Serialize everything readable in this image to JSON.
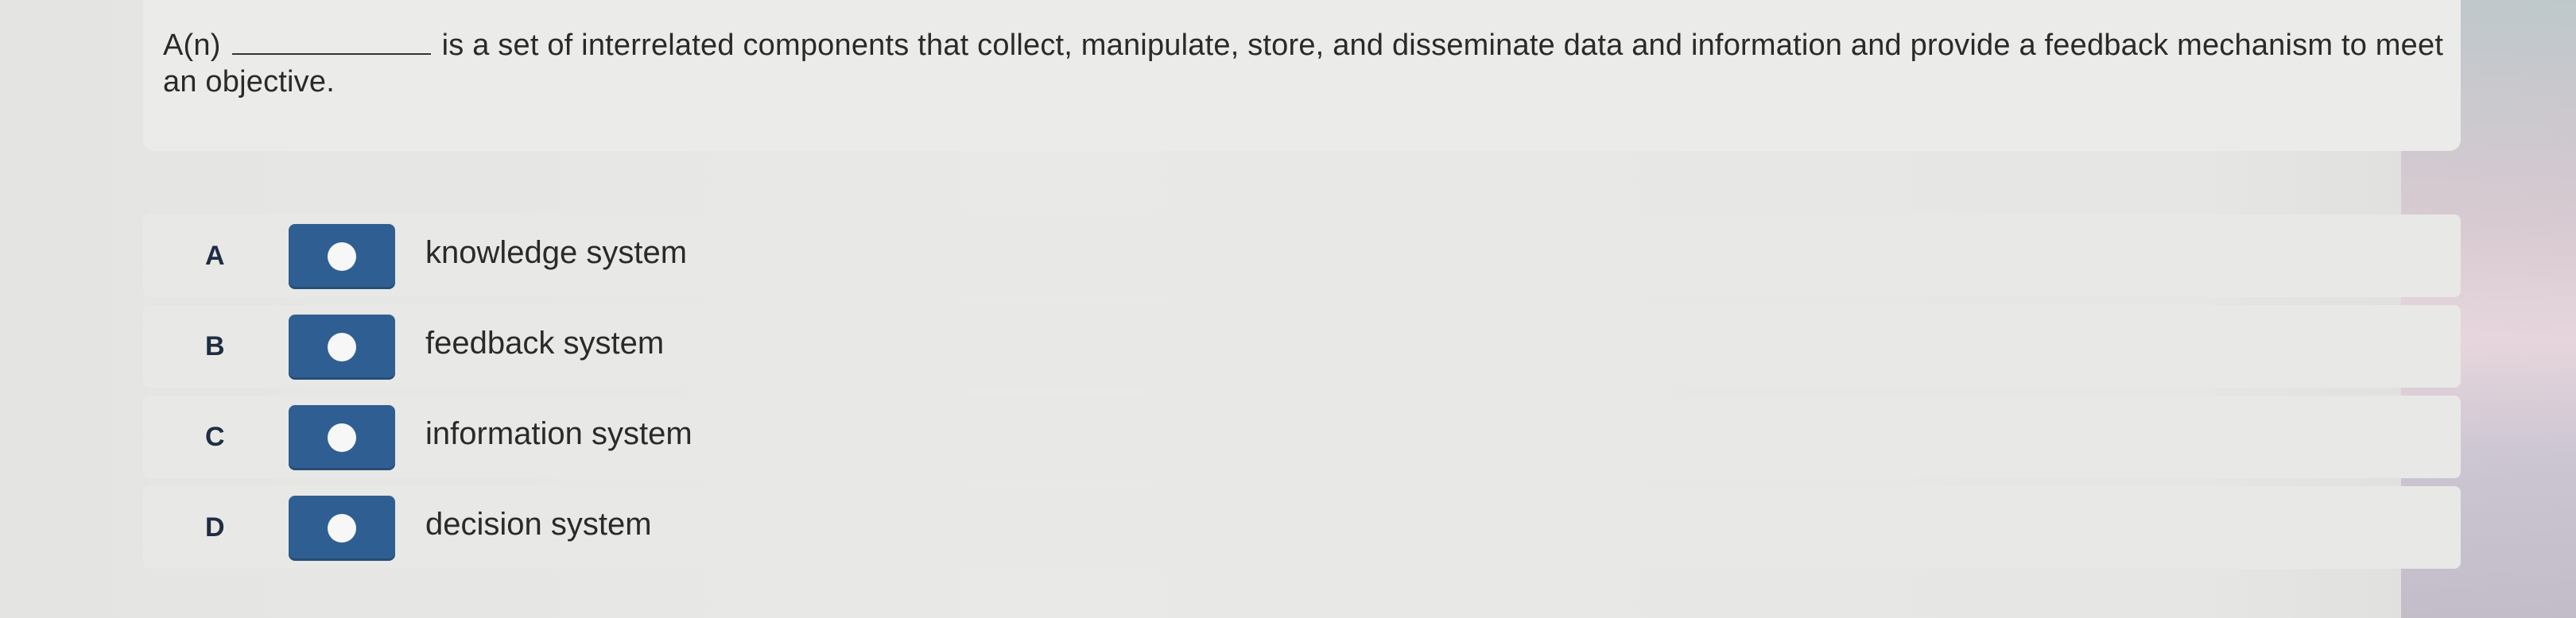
{
  "question": {
    "prefix": "A(n)",
    "text_after_blank": "is a set of interrelated components that collect, manipulate, store, and disseminate data and information and provide a feedback mechanism to meet an objective."
  },
  "options": [
    {
      "letter": "A",
      "label": "knowledge system"
    },
    {
      "letter": "B",
      "label": "feedback system"
    },
    {
      "letter": "C",
      "label": "information system"
    },
    {
      "letter": "D",
      "label": "decision system"
    }
  ],
  "colors": {
    "radio_fill": "#2f5f92",
    "radio_dot": "#f7f7f7",
    "letter": "#1f2d44"
  }
}
